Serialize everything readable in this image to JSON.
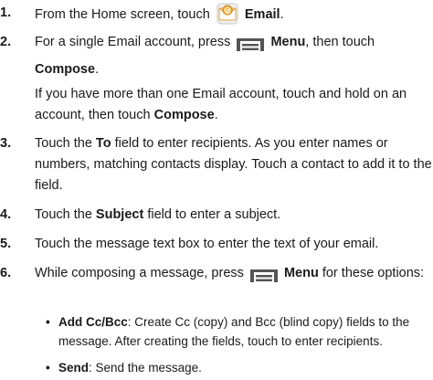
{
  "steps": [
    {
      "num": "1.",
      "pre": "From the Home screen, touch",
      "bold1": "Email",
      "icon": "email-app-icon"
    },
    {
      "num": "2.",
      "pre": "For a single Email account, press",
      "bold1": "Menu",
      "mid": ", then touch",
      "bold2": "Compose",
      "post": ".",
      "icon": "menu-key-icon"
    },
    {
      "sub_pre": "If you have more than one Email account, touch and hold on an account, then touch",
      "sub_bold": "Compose",
      "sub_post": "."
    },
    {
      "num": "3.",
      "pre": "Touch the",
      "bold1": "To",
      "post": "field to enter recipients. As you enter names or numbers, matching contacts display. Touch a contact to add it to the field."
    },
    {
      "num": "4.",
      "pre": "Touch the",
      "bold1": "Subject",
      "post": "field to enter a subject."
    },
    {
      "num": "5.",
      "text": "Touch the message text box to enter the text of your email."
    },
    {
      "num": "6.",
      "pre": "While composing a message, press",
      "bold1": "Menu",
      "post": "for these options:",
      "icon": "menu-key-icon"
    }
  ],
  "bullets": [
    {
      "dot": "•",
      "bold": "Add Cc/Bcc",
      "text": ": Create Cc (copy) and Bcc (blind copy) fields to the message. After creating the fields, touch to enter recipients."
    },
    {
      "dot": "•",
      "bold": "Send",
      "text": ": Send the message."
    }
  ]
}
